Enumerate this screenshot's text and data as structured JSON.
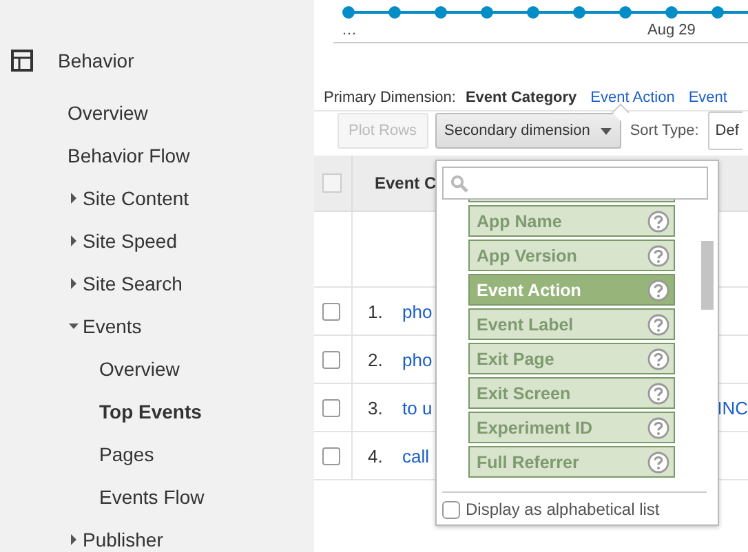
{
  "sidebar": {
    "section": {
      "label": "Behavior",
      "items": [
        {
          "label": "Overview",
          "kind": "page",
          "selected": false
        },
        {
          "label": "Behavior Flow",
          "kind": "page",
          "selected": false
        },
        {
          "label": "Site Content",
          "kind": "group",
          "expanded": false
        },
        {
          "label": "Site Speed",
          "kind": "group",
          "expanded": false
        },
        {
          "label": "Site Search",
          "kind": "group",
          "expanded": false
        },
        {
          "label": "Events",
          "kind": "group",
          "expanded": true,
          "children": [
            {
              "label": "Overview",
              "kind": "page",
              "selected": false
            },
            {
              "label": "Top Events",
              "kind": "page",
              "selected": true
            },
            {
              "label": "Pages",
              "kind": "page",
              "selected": false
            },
            {
              "label": "Events Flow",
              "kind": "page",
              "selected": false
            }
          ]
        },
        {
          "label": "Publisher",
          "kind": "group",
          "expanded": false
        }
      ]
    }
  },
  "chart": {
    "x_labels": [
      "…",
      "Aug 29"
    ]
  },
  "primary_dimension": {
    "label": "Primary Dimension:",
    "options": [
      {
        "label": "Event Category",
        "selected": true
      },
      {
        "label": "Event Action",
        "selected": false
      },
      {
        "label": "Event",
        "selected": false
      }
    ]
  },
  "toolbar": {
    "plot_rows": {
      "label": "Plot Rows",
      "disabled": true
    },
    "secondary_dimension": {
      "label": "Secondary dimension"
    },
    "sort_type": {
      "label": "Sort Type:",
      "value": "Def"
    }
  },
  "table": {
    "columns": [
      {
        "label": "Event C"
      }
    ],
    "select_all": {
      "checked": false
    },
    "rows": [
      {
        "checked": false,
        "number": "1.",
        "event": "pho"
      },
      {
        "checked": false,
        "number": "2.",
        "event": "pho"
      },
      {
        "checked": false,
        "number": "3.",
        "event": "to u",
        "column_3": "INC"
      },
      {
        "checked": false,
        "number": "4.",
        "event": "call"
      }
    ]
  },
  "dimension_menu": {
    "items": [
      {
        "label": "App Name",
        "selected": false
      },
      {
        "label": "App Version",
        "selected": false
      },
      {
        "label": "Event Action",
        "selected": true
      },
      {
        "label": "Event Label",
        "selected": false
      },
      {
        "label": "Exit Page",
        "selected": false
      },
      {
        "label": "Exit Screen",
        "selected": false
      },
      {
        "label": "Experiment ID",
        "selected": false
      },
      {
        "label": "Full Referrer",
        "selected": false
      }
    ],
    "alphabetical": {
      "label": "Display as alphabetical list",
      "checked": false
    }
  }
}
